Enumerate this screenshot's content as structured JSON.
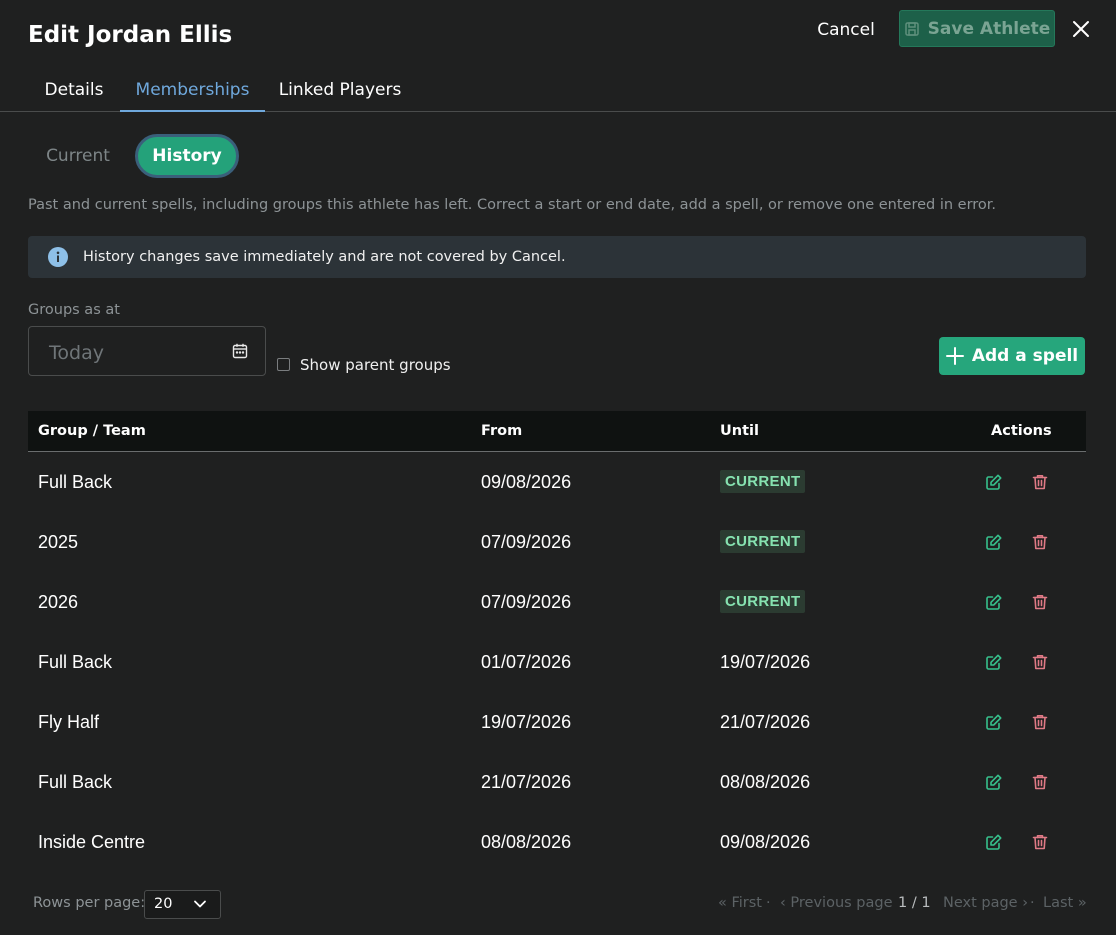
{
  "header": {
    "title": "Edit Jordan Ellis",
    "cancel_label": "Cancel",
    "save_label": "Save Athlete"
  },
  "tabs": [
    {
      "label": "Details",
      "active": false
    },
    {
      "label": "Memberships",
      "active": true
    },
    {
      "label": "Linked Players",
      "active": false
    }
  ],
  "segment": {
    "current_label": "Current",
    "history_label": "History",
    "selected": "History"
  },
  "description": "Past and current spells, including groups this athlete has left. Correct a start or end date, add a spell, or remove one entered in error.",
  "info_banner": "History changes save immediately and are not covered by Cancel.",
  "filters": {
    "as_at_label": "Groups as at",
    "date_placeholder": "Today",
    "show_parent_label": "Show parent groups",
    "show_parent_checked": false
  },
  "add_spell_label": "Add a spell",
  "table": {
    "headers": {
      "group": "Group / Team",
      "from": "From",
      "until": "Until",
      "actions": "Actions"
    },
    "rows": [
      {
        "group": "Full Back",
        "from": "09/08/2026",
        "until": "CURRENT"
      },
      {
        "group": "2025",
        "from": "07/09/2026",
        "until": "CURRENT"
      },
      {
        "group": "2026",
        "from": "07/09/2026",
        "until": "CURRENT"
      },
      {
        "group": "Full Back",
        "from": "01/07/2026",
        "until": "19/07/2026"
      },
      {
        "group": "Fly Half",
        "from": "19/07/2026",
        "until": "21/07/2026"
      },
      {
        "group": "Full Back",
        "from": "21/07/2026",
        "until": "08/08/2026"
      },
      {
        "group": "Inside Centre",
        "from": "08/08/2026",
        "until": "09/08/2026"
      }
    ]
  },
  "pagination": {
    "rows_per_page_label": "Rows per page:",
    "rows_per_page_value": "20",
    "first": "« First",
    "prev": "‹ Previous page",
    "current": "1 / 1",
    "next": "Next page ›",
    "last": "Last »",
    "sep": "·"
  },
  "icons": {
    "save": "floppy-disk-icon",
    "close": "close-icon",
    "info": "info-circle-icon",
    "calendar": "calendar-icon",
    "add": "plus-icon",
    "edit": "edit-icon",
    "delete": "trash-icon",
    "dropdown": "chevron-down-icon"
  },
  "colors": {
    "accent_green": "#26a67c",
    "tab_active": "#6fa8dc",
    "current_badge_text": "#86e2b0",
    "delete_icon": "#e07a86"
  }
}
